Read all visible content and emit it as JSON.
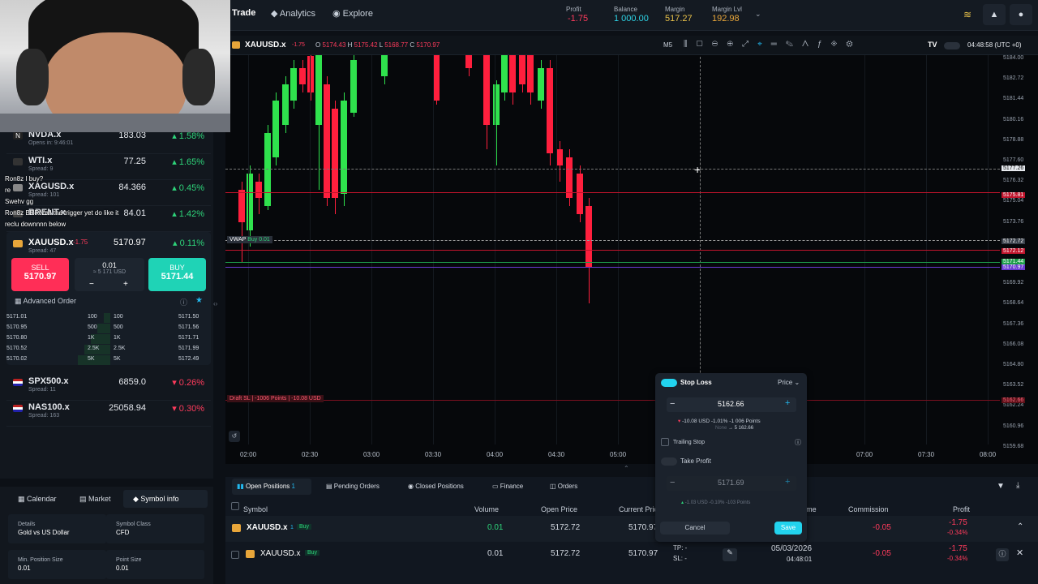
{
  "topbar": {
    "trade": "Trade",
    "analytics": "Analytics",
    "explore": "Explore",
    "profit_label": "Profit",
    "profit_value": "-1.75",
    "balance_label": "Balance",
    "balance_value": "1 000.00",
    "margin_label": "Margin",
    "margin_value": "517.27",
    "margin_lvl_label": "Margin Lvl",
    "margin_lvl_value": "192.98"
  },
  "chat": {
    "l1": "Ron8z  I buy?",
    "l2": "re",
    "l3": "Swehv  gg",
    "l4": "Ron8z  BRRN'all the trigger yet do like it",
    "l5": "reclu  downnnn below"
  },
  "symbols": [
    {
      "name": "NVDA.x",
      "sub": "Opens in: 9:46:01",
      "price": "183.03",
      "chg": "1.58%",
      "logo": "N"
    },
    {
      "name": "WTI.x",
      "sub": "Spread: 9",
      "price": "77.25",
      "chg": "1.65%"
    },
    {
      "name": "XAGUSD.x",
      "sub": "Spread: 101",
      "price": "84.366",
      "chg": "0.45%"
    },
    {
      "name": "BRENT.x",
      "sub": "",
      "price": "84.01",
      "chg": "1.42%"
    }
  ],
  "selected": {
    "name": "XAUUSD.x",
    "badge": "-1.75",
    "sub": "Spread: 47",
    "price": "5170.97",
    "chg": "0.11%",
    "sell_label": "SELL",
    "sell_price": "5170.97",
    "buy_label": "BUY",
    "buy_price": "5171.44",
    "qty": "0.01",
    "qty_usd": "≈ 5 171 USD",
    "minus": "−",
    "plus": "+",
    "advanced": "Advanced Order"
  },
  "orderbook": [
    {
      "bid": "5171.01",
      "v1": "100",
      "v2": "100",
      "ask": "5171.50"
    },
    {
      "bid": "5170.95",
      "v1": "500",
      "v2": "500",
      "ask": "5171.56"
    },
    {
      "bid": "5170.80",
      "v1": "1K",
      "v2": "1K",
      "ask": "5171.71"
    },
    {
      "bid": "5170.52",
      "v1": "2.5K",
      "v2": "2.5K",
      "ask": "5171.99"
    },
    {
      "bid": "5170.02",
      "v1": "5K",
      "v2": "5K",
      "ask": "5172.49"
    }
  ],
  "symbols2": [
    {
      "name": "SPX500.x",
      "sub": "Spread: 11",
      "price": "6859.0",
      "chg": "0.26%"
    },
    {
      "name": "NAS100.x",
      "sub": "Spread: 163",
      "price": "25058.94",
      "chg": "0.30%"
    }
  ],
  "sidebot": {
    "tab1": "Calendar",
    "tab2": "Market",
    "tab3": "Symbol info",
    "details_label": "Details",
    "details_value": "Gold vs US Dollar",
    "class_label": "Symbol Class",
    "class_value": "CFD",
    "minpos_label": "Min. Position Size",
    "minpos_value": "0.01",
    "point_label": "Point Size",
    "point_value": "0.01"
  },
  "chart": {
    "symbol": "XAUUSD.x",
    "badge": "-1.75",
    "o_label": "O",
    "o": "5174.43",
    "h_label": "H",
    "h": "5175.42",
    "l_label": "L",
    "l": "5168.77",
    "c_label": "C",
    "c": "5170.97",
    "timeframe": "M5",
    "clock": "04:48:58 (UTC +0)",
    "vwap": "VWAP",
    "buy_line": "Buy 0.01",
    "draft_sl": "Draft SL | -1006 Points | -10.08 USD",
    "price_axis": [
      "5184.00",
      "5182.72",
      "5181.44",
      "5180.16",
      "5178.88",
      "5177.60",
      "5176.32",
      "5175.04",
      "5173.76",
      "5172.48",
      "5171.20",
      "5169.92",
      "5168.64",
      "5167.36",
      "5166.08",
      "5164.80",
      "5163.52",
      "5162.24",
      "5160.96",
      "5159.68"
    ],
    "price_tags": {
      "cross": "5177.26",
      "red1": "5175.81",
      "grey": "5172.72",
      "red2": "5172.12",
      "green": "5171.44",
      "purple": "5170.97",
      "sl": "5162.66"
    },
    "time_axis": [
      "02:00",
      "02:30",
      "03:00",
      "03:30",
      "04:00",
      "04:30",
      "05:00",
      "07:00",
      "07:30",
      "08:00"
    ]
  },
  "stoploss": {
    "title": "Stop Loss",
    "mode": "Price",
    "value": "5162.66",
    "usd": "-10.08 USD",
    "pct": "-1.01%",
    "points": "-1 006 Points",
    "none": "None",
    "arrow_val": "→ 5 162.66",
    "trailing": "Trailing Stop",
    "tp_title": "Take Profit",
    "tp_value": "5171.69",
    "tp_usd": "-1.03 USD",
    "tp_pct": "-0.10%",
    "tp_points": "-103 Points",
    "cancel": "Cancel",
    "save": "Save"
  },
  "bottom": {
    "tab_open": "Open Positions",
    "open_count": "1",
    "tab_pending": "Pending Orders",
    "tab_closed": "Closed Positions",
    "tab_finance": "Finance",
    "tab_orders": "Orders",
    "h_symbol": "Symbol",
    "h_volume": "Volume",
    "h_open": "Open Price",
    "h_current": "Current Price",
    "h_time": "Time",
    "h_comm": "Commission",
    "h_profit": "Profit",
    "rows": [
      {
        "symbol": "XAUUSD.x",
        "count": "1",
        "side": "Buy",
        "volume": "0.01",
        "open": "5172.72",
        "current": "5170.97",
        "tp": "",
        "sl": "",
        "date": "",
        "time": "",
        "comm": "-0.05",
        "profit": "-1.75",
        "pct": "-0.34%"
      },
      {
        "symbol": "XAUUSD.x",
        "count": "",
        "side": "Buy",
        "volume": "0.01",
        "open": "5172.72",
        "current": "5170.97",
        "tp": "TP: -",
        "sl": "SL: -",
        "date": "05/03/2026",
        "time": "04:48:01",
        "comm": "-0.05",
        "profit": "-1.75",
        "pct": "-0.34%"
      }
    ]
  },
  "colors": {
    "up": "#2ed47a",
    "down": "#ff1f3d",
    "accent": "#22d3ee"
  }
}
